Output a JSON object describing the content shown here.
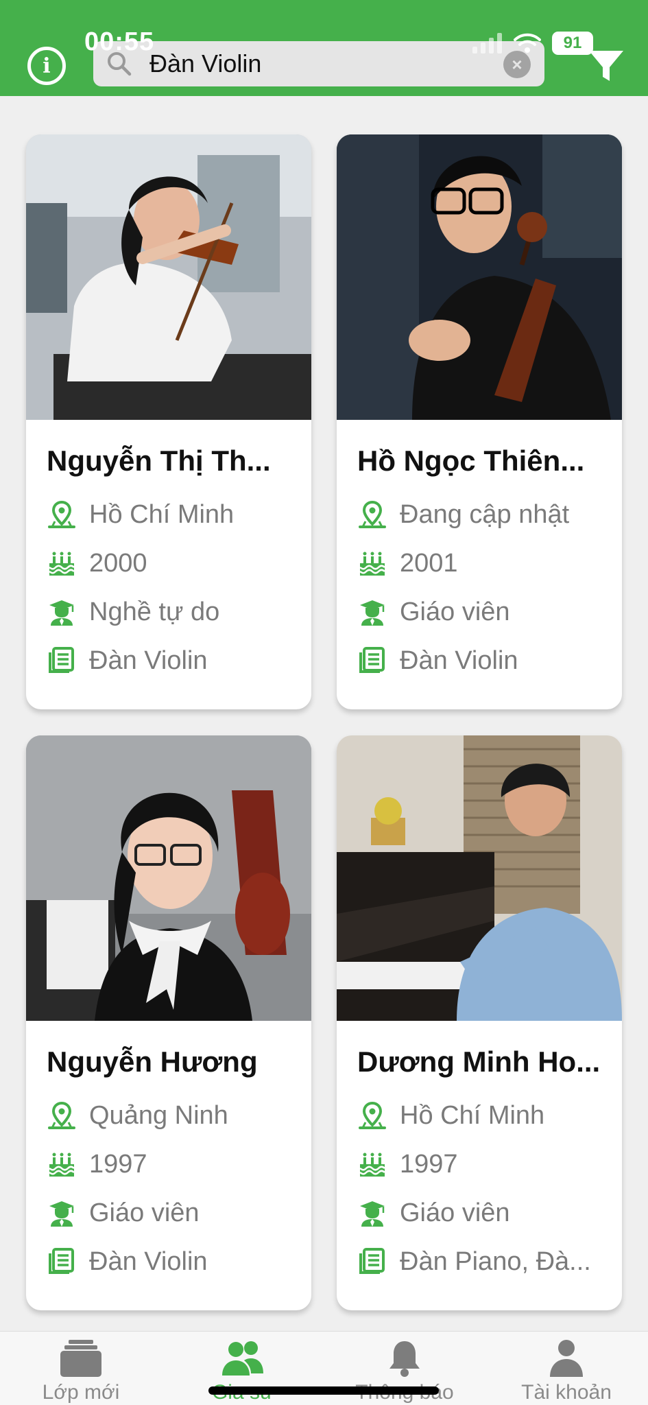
{
  "status_bar": {
    "time": "00:55",
    "battery": "91"
  },
  "search": {
    "value": "Đàn Violin"
  },
  "icons": {
    "info": "info-icon",
    "search": "search-icon",
    "clear": "clear-icon",
    "filter": "filter-icon",
    "location": "location-pin-icon",
    "birth_year": "birthday-cake-icon",
    "occupation": "graduate-icon",
    "subject": "book-icon"
  },
  "colors": {
    "brand_green": "#45b04b",
    "text_gray": "#7a7a7a"
  },
  "tutors": [
    {
      "name": "Nguyễn Thị Th...",
      "location": "Hồ Chí Minh",
      "birth_year": "2000",
      "occupation": "Nghề tự do",
      "subjects": "Đàn Violin"
    },
    {
      "name": "Hồ Ngọc Thiên...",
      "location": "Đang cập nhật",
      "birth_year": "2001",
      "occupation": "Giáo viên",
      "subjects": "Đàn Violin"
    },
    {
      "name": "Nguyễn Hương",
      "location": "Quảng Ninh",
      "birth_year": "1997",
      "occupation": "Giáo viên",
      "subjects": "Đàn Violin"
    },
    {
      "name": "Dương Minh Ho...",
      "location": "Hồ Chí Minh",
      "birth_year": "1997",
      "occupation": "Giáo viên",
      "subjects": "Đàn Piano, Đà..."
    }
  ],
  "nav": {
    "items": [
      {
        "label": "Lớp mới",
        "icon": "classes-stack-icon"
      },
      {
        "label": "Gia sư",
        "icon": "tutors-people-icon",
        "active": true
      },
      {
        "label": "Thông báo",
        "icon": "bell-icon"
      },
      {
        "label": "Tài khoản",
        "icon": "account-person-icon"
      }
    ]
  }
}
